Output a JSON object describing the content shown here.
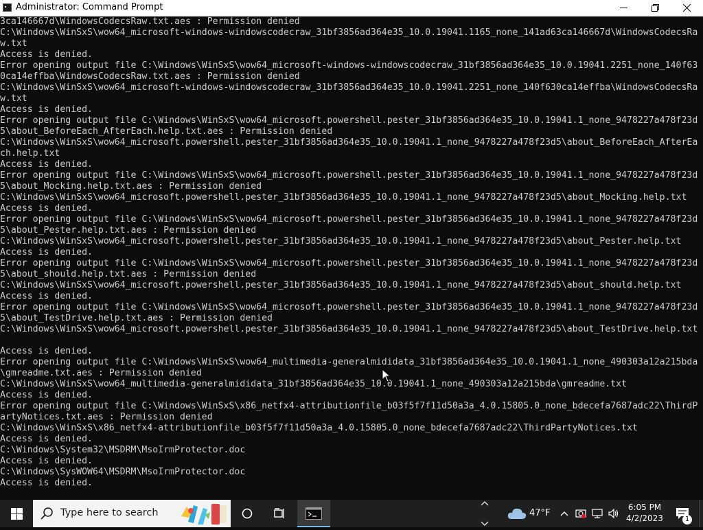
{
  "window": {
    "title": "Administrator:  Command Prompt"
  },
  "console": {
    "lines": [
      "3ca146667d\\WindowsCodecsRaw.txt.aes : Permission denied",
      "C:\\Windows\\WinSxS\\wow64_microsoft-windows-windowscodecraw_31bf3856ad364e35_10.0.19041.1165_none_141ad63ca146667d\\WindowsCodecsRa",
      "w.txt",
      "Access is denied.",
      "Error opening output file C:\\Windows\\WinSxS\\wow64_microsoft-windows-windowscodecraw_31bf3856ad364e35_10.0.19041.2251_none_140f63",
      "0ca14effba\\WindowsCodecsRaw.txt.aes : Permission denied",
      "C:\\Windows\\WinSxS\\wow64_microsoft-windows-windowscodecraw_31bf3856ad364e35_10.0.19041.2251_none_140f630ca14effba\\WindowsCodecsRa",
      "w.txt",
      "Access is denied.",
      "Error opening output file C:\\Windows\\WinSxS\\wow64_microsoft.powershell.pester_31bf3856ad364e35_10.0.19041.1_none_9478227a478f23d",
      "5\\about_BeforeEach_AfterEach.help.txt.aes : Permission denied",
      "C:\\Windows\\WinSxS\\wow64_microsoft.powershell.pester_31bf3856ad364e35_10.0.19041.1_none_9478227a478f23d5\\about_BeforeEach_AfterEa",
      "ch.help.txt",
      "Access is denied.",
      "Error opening output file C:\\Windows\\WinSxS\\wow64_microsoft.powershell.pester_31bf3856ad364e35_10.0.19041.1_none_9478227a478f23d",
      "5\\about_Mocking.help.txt.aes : Permission denied",
      "C:\\Windows\\WinSxS\\wow64_microsoft.powershell.pester_31bf3856ad364e35_10.0.19041.1_none_9478227a478f23d5\\about_Mocking.help.txt",
      "Access is denied.",
      "Error opening output file C:\\Windows\\WinSxS\\wow64_microsoft.powershell.pester_31bf3856ad364e35_10.0.19041.1_none_9478227a478f23d",
      "5\\about_Pester.help.txt.aes : Permission denied",
      "C:\\Windows\\WinSxS\\wow64_microsoft.powershell.pester_31bf3856ad364e35_10.0.19041.1_none_9478227a478f23d5\\about_Pester.help.txt",
      "Access is denied.",
      "Error opening output file C:\\Windows\\WinSxS\\wow64_microsoft.powershell.pester_31bf3856ad364e35_10.0.19041.1_none_9478227a478f23d",
      "5\\about_should.help.txt.aes : Permission denied",
      "C:\\Windows\\WinSxS\\wow64_microsoft.powershell.pester_31bf3856ad364e35_10.0.19041.1_none_9478227a478f23d5\\about_should.help.txt",
      "Access is denied.",
      "Error opening output file C:\\Windows\\WinSxS\\wow64_microsoft.powershell.pester_31bf3856ad364e35_10.0.19041.1_none_9478227a478f23d",
      "5\\about_TestDrive.help.txt.aes : Permission denied",
      "C:\\Windows\\WinSxS\\wow64_microsoft.powershell.pester_31bf3856ad364e35_10.0.19041.1_none_9478227a478f23d5\\about_TestDrive.help.txt",
      "",
      "Access is denied.",
      "Error opening output file C:\\Windows\\WinSxS\\wow64_multimedia-generalmididata_31bf3856ad364e35_10.0.19041.1_none_490303a12a215bda",
      "\\gmreadme.txt.aes : Permission denied",
      "C:\\Windows\\WinSxS\\wow64_multimedia-generalmididata_31bf3856ad364e35_10.0.19041.1_none_490303a12a215bda\\gmreadme.txt",
      "Access is denied.",
      "Error opening output file C:\\Windows\\WinSxS\\x86_netfx4-attributionfile_b03f5f7f11d50a3a_4.0.15805.0_none_bdecefa7687adc22\\ThirdP",
      "artyNotices.txt.aes : Permission denied",
      "C:\\Windows\\WinSxS\\x86_netfx4-attributionfile_b03f5f7f11d50a3a_4.0.15805.0_none_bdecefa7687adc22\\ThirdPartyNotices.txt",
      "Access is denied.",
      "C:\\Windows\\System32\\MSDRM\\MsoIrmProtector.doc",
      "Access is denied.",
      "C:\\Windows\\SysWOW64\\MSDRM\\MsoIrmProtector.doc",
      "Access is denied."
    ]
  },
  "taskbar": {
    "search_placeholder": "Type here to search",
    "weather": {
      "temperature": "47°F",
      "icon": "cloud-icon"
    },
    "clock": {
      "time": "6:05 PM",
      "date": "4/2/2023"
    },
    "notification_count": "1"
  },
  "colors": {
    "console_bg": "#0c0c0c",
    "console_fg": "#cccccc",
    "taskbar_bg": "#1f1f1f",
    "accent": "#76b9ed"
  }
}
